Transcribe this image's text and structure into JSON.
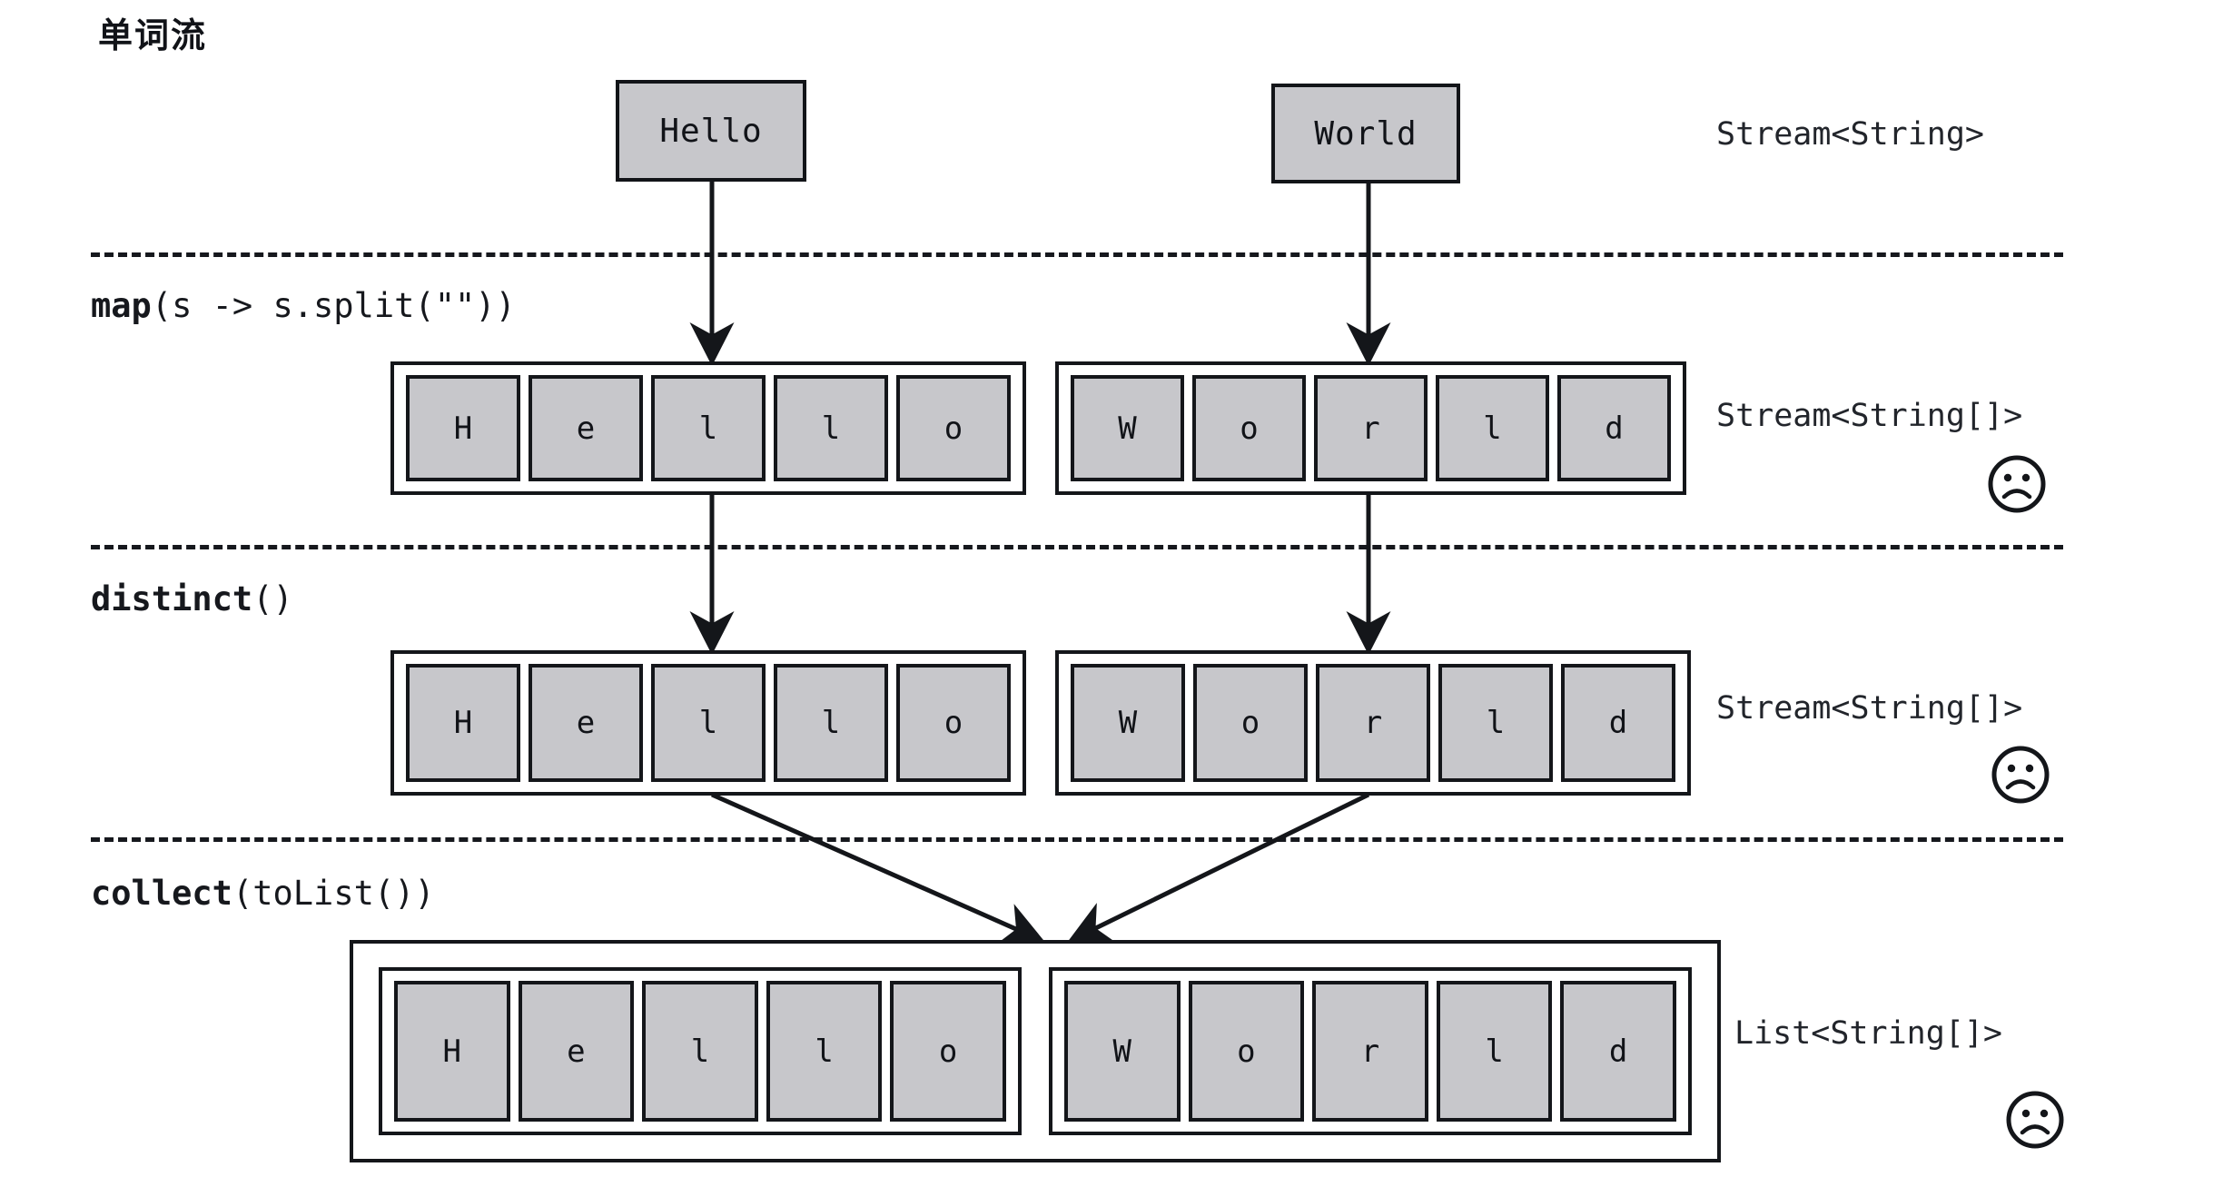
{
  "title": "单词流",
  "stages": [
    {
      "id": "source",
      "op_bold": "",
      "op_rest": "",
      "type_label": "Stream<String>",
      "items": [
        {
          "kind": "word",
          "text": "Hello"
        },
        {
          "kind": "word",
          "text": "World"
        }
      ],
      "sad": false
    },
    {
      "id": "map",
      "op_bold": "map",
      "op_rest": "(s -> s.split(\"\"))",
      "type_label": "Stream<String[]>",
      "items": [
        {
          "kind": "array",
          "cells": [
            "H",
            "e",
            "l",
            "l",
            "o"
          ]
        },
        {
          "kind": "array",
          "cells": [
            "W",
            "o",
            "r",
            "l",
            "d"
          ]
        }
      ],
      "sad": true
    },
    {
      "id": "distinct",
      "op_bold": "distinct",
      "op_rest": "()",
      "type_label": "Stream<String[]>",
      "items": [
        {
          "kind": "array",
          "cells": [
            "H",
            "e",
            "l",
            "l",
            "o"
          ]
        },
        {
          "kind": "array",
          "cells": [
            "W",
            "o",
            "r",
            "l",
            "d"
          ]
        }
      ],
      "sad": true
    },
    {
      "id": "collect",
      "op_bold": "collect",
      "op_rest": "(toList())",
      "type_label": "List<String[]>",
      "items": [
        {
          "kind": "array",
          "cells": [
            "H",
            "e",
            "l",
            "l",
            "o"
          ]
        },
        {
          "kind": "array",
          "cells": [
            "W",
            "o",
            "r",
            "l",
            "d"
          ]
        }
      ],
      "sad": true
    }
  ],
  "icons": {
    "sad_face": "sad-face-icon",
    "arrow_down": "arrow-down-icon",
    "arrow_merge": "arrow-merge-icon"
  },
  "colors": {
    "cell_fill": "#c7c7cb",
    "stroke": "#14161a",
    "text": "#111318",
    "background": "#ffffff"
  }
}
